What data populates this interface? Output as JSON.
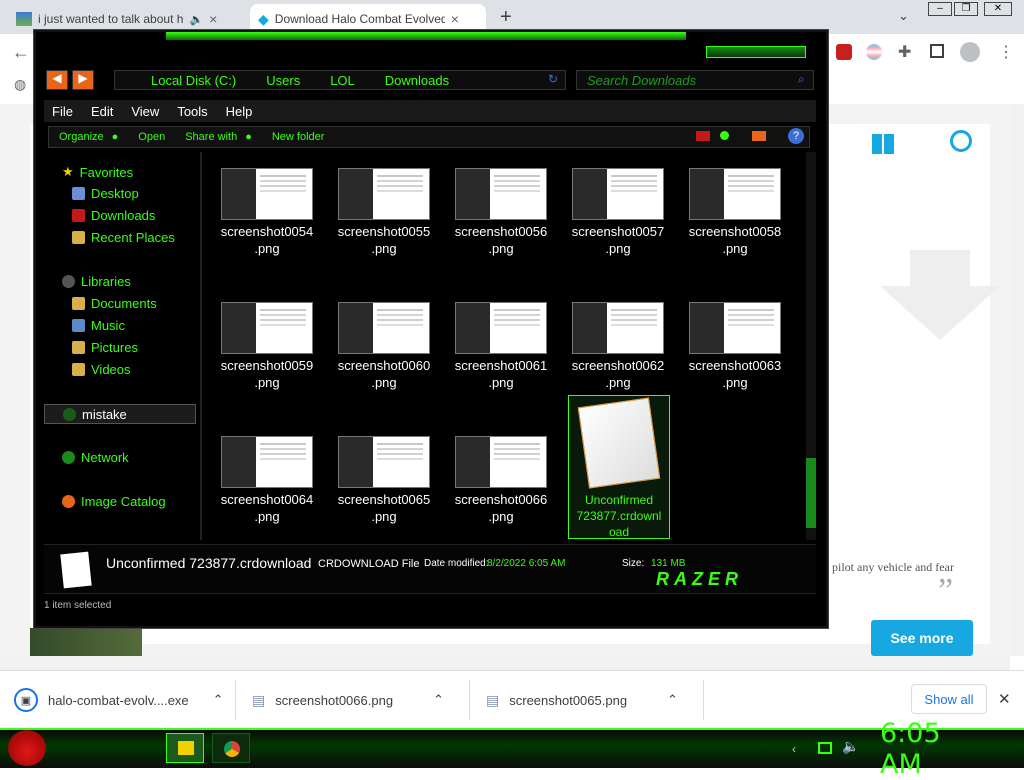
{
  "browser": {
    "tabs": [
      {
        "title": "i just wanted to talk about h",
        "close": "×"
      },
      {
        "title": "Download Halo Combat Evolved",
        "close": "×"
      }
    ],
    "new_tab": "+",
    "window_controls": {
      "chevron": "⌄",
      "minimize": "–",
      "restore": "❐",
      "close": "✕"
    }
  },
  "page": {
    "see_more": "See more",
    "snippet": "pilot any vehicle and fear",
    "quote_mark": "”"
  },
  "explorer": {
    "breadcrumb": [
      "Local Disk (C:)",
      "Users",
      "LOL",
      "Downloads"
    ],
    "search_placeholder": "Search Downloads",
    "menu": [
      "File",
      "Edit",
      "View",
      "Tools",
      "Help"
    ],
    "commands": [
      "Organize",
      "Open",
      "Share with",
      "New folder"
    ],
    "nav": {
      "favorites": "Favorites",
      "desktop": "Desktop",
      "downloads": "Downloads",
      "recent": "Recent Places",
      "libraries": "Libraries",
      "documents": "Documents",
      "music": "Music",
      "pictures": "Pictures",
      "videos": "Videos",
      "mistake": "mistake",
      "network": "Network",
      "image_catalog": "Image Catalog"
    },
    "files": [
      {
        "name1": "screenshot0054",
        "name2": ".png"
      },
      {
        "name1": "screenshot0055",
        "name2": ".png"
      },
      {
        "name1": "screenshot0056",
        "name2": ".png"
      },
      {
        "name1": "screenshot0057",
        "name2": ".png"
      },
      {
        "name1": "screenshot0058",
        "name2": ".png"
      },
      {
        "name1": "screenshot0059",
        "name2": ".png"
      },
      {
        "name1": "screenshot0060",
        "name2": ".png"
      },
      {
        "name1": "screenshot0061",
        "name2": ".png"
      },
      {
        "name1": "screenshot0062",
        "name2": ".png"
      },
      {
        "name1": "screenshot0063",
        "name2": ".png"
      },
      {
        "name1": "screenshot0064",
        "name2": ".png"
      },
      {
        "name1": "screenshot0065",
        "name2": ".png"
      },
      {
        "name1": "screenshot0066",
        "name2": ".png"
      }
    ],
    "selected_file": {
      "line1": "Unconfirmed",
      "line2": "723877.crdownl",
      "line3": "oad"
    },
    "details": {
      "filename": "Unconfirmed 723877.crdownload",
      "type": "CRDOWNLOAD File",
      "date_label": "Date modified:",
      "date_value": "8/2/2022 6:05 AM",
      "size_label": "Size:",
      "size_value": "131 MB",
      "brand": "RAZER"
    },
    "status": "1 item selected"
  },
  "downloads_bar": {
    "items": [
      {
        "name": "halo-combat-evolv....exe"
      },
      {
        "name": "screenshot0066.png"
      },
      {
        "name": "screenshot0065.png"
      }
    ],
    "show_all": "Show all",
    "close": "✕"
  },
  "taskbar": {
    "clock": "6:05 AM"
  },
  "colors": {
    "accent_green": "#39ff14",
    "chrome_blue": "#17a8e1"
  }
}
